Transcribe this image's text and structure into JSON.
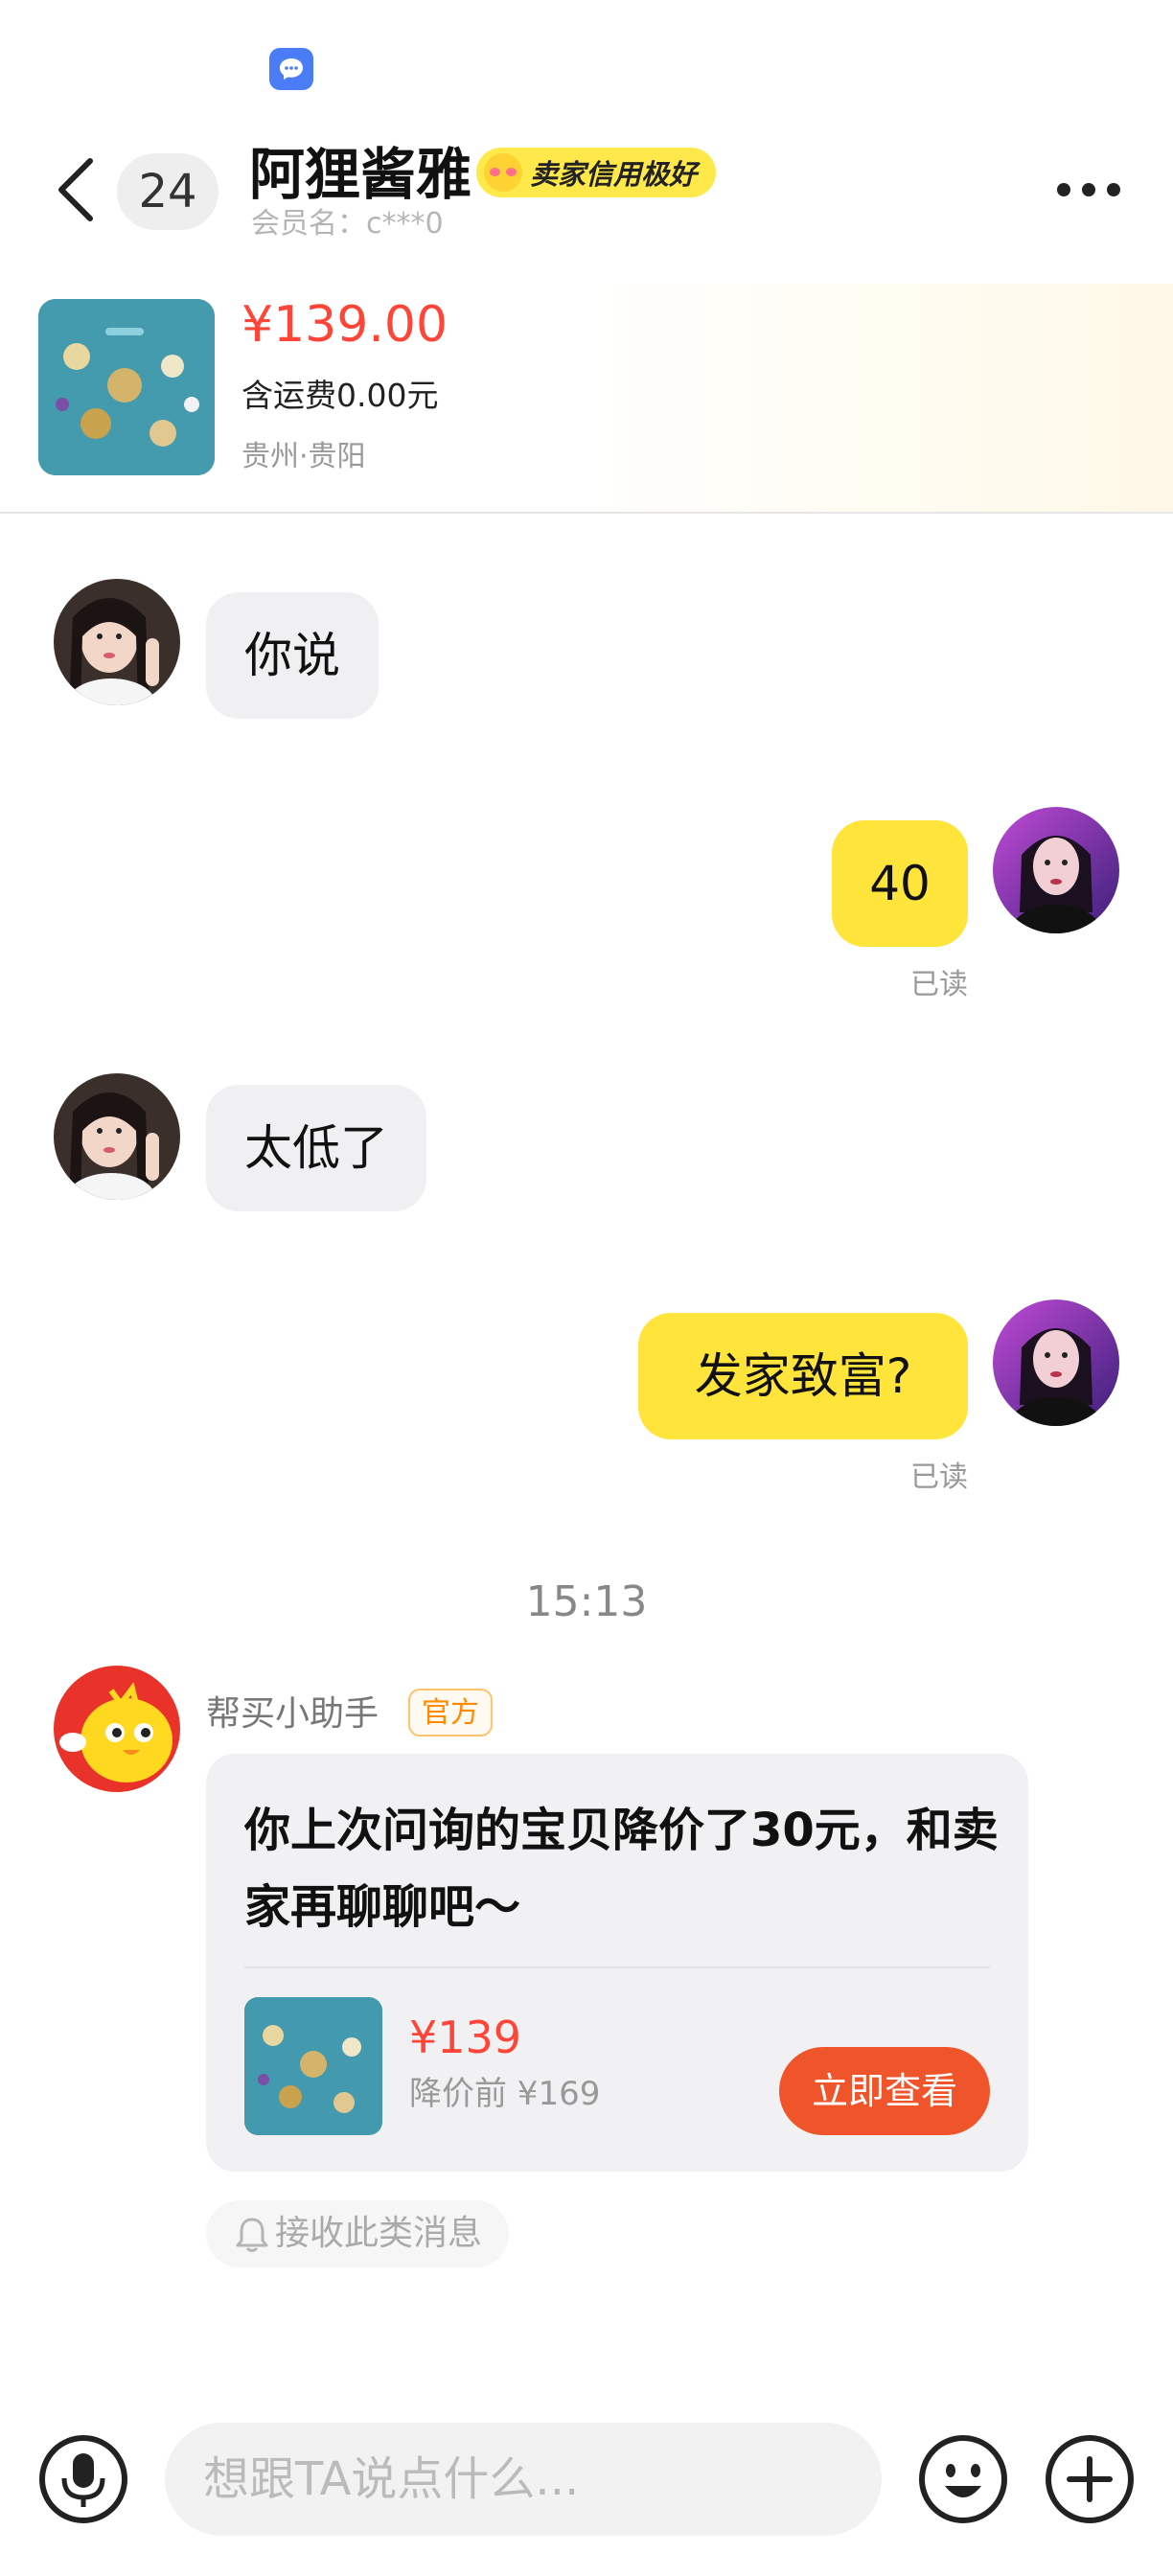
{
  "header": {
    "unread_count": "24",
    "seller_name": "阿狸酱雅",
    "credit_badge": "卖家信用极好",
    "member_line": "会员名：c***0"
  },
  "product": {
    "price": "¥139.00",
    "shipping": "含运费0.00元",
    "location": "贵州·贵阳"
  },
  "messages": [
    {
      "side": "in",
      "text": "你说"
    },
    {
      "side": "out",
      "text": "40",
      "status": "已读"
    },
    {
      "side": "in",
      "text": "太低了"
    },
    {
      "side": "out",
      "text": "发家致富?",
      "status": "已读"
    }
  ],
  "time_divider": "15:13",
  "assistant": {
    "name": "帮买小助手",
    "tag": "官方",
    "message": "你上次问询的宝贝降价了30元，和卖家再聊聊吧～",
    "price": "¥139",
    "original_price": "降价前 ¥169",
    "button": "立即查看",
    "subscribe": "接收此类消息"
  },
  "input": {
    "placeholder": "想跟TA说点什么..."
  },
  "icons": {
    "status": "chat-bubble-icon",
    "back": "chevron-left-icon",
    "more": "more-dots-icon",
    "mic": "microphone-icon",
    "emoji": "smiley-icon",
    "plus": "plus-icon",
    "bell": "bell-icon"
  },
  "colors": {
    "accent_yellow": "#ffe43c",
    "price_red": "#ff4438",
    "button_orange": "#f0542a"
  }
}
